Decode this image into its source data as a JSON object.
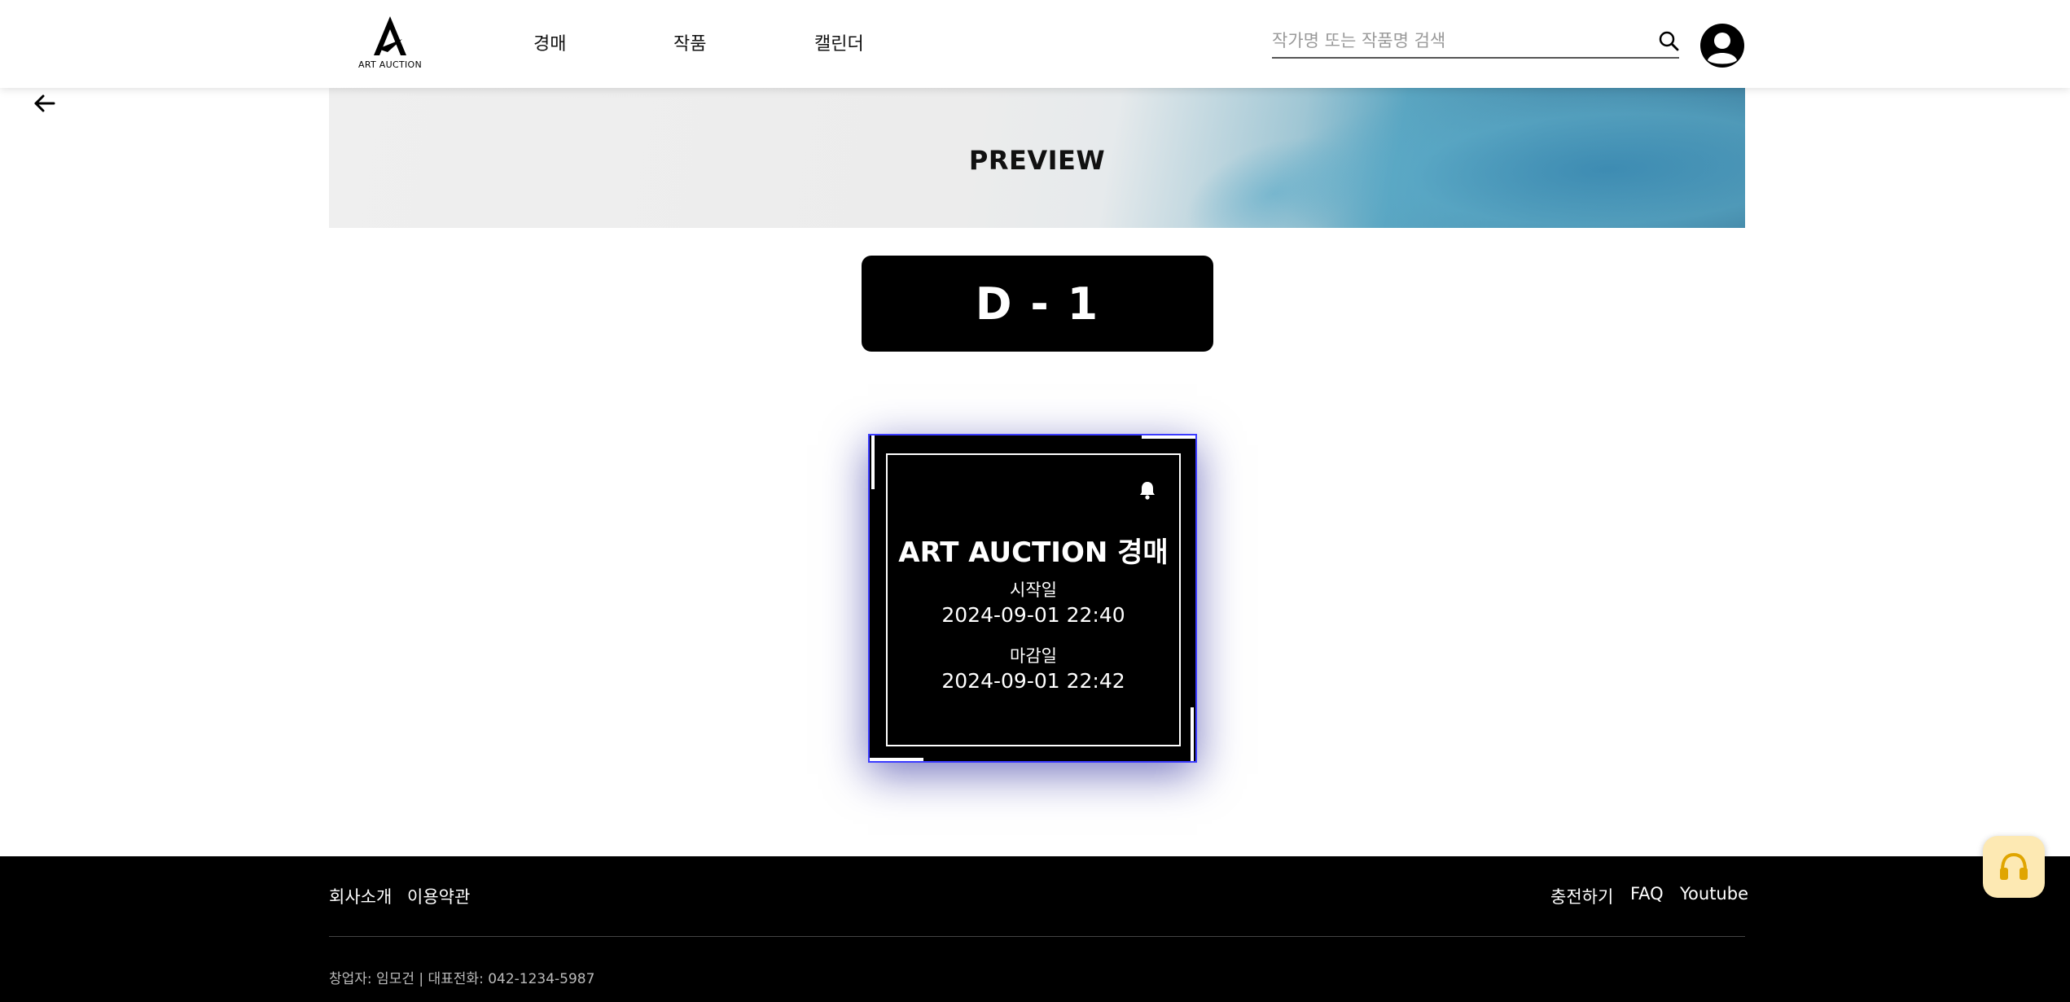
{
  "header": {
    "logo_text": "ART AUCTION",
    "nav": [
      "경매",
      "작품",
      "캘린더"
    ],
    "search_placeholder": "작가명 또는 작품명 검색"
  },
  "banner": {
    "title": "PREVIEW"
  },
  "countdown": {
    "label": "D - 1"
  },
  "auction_card": {
    "title": "ART AUCTION 경매",
    "start_label": "시작일",
    "start_date": "2024-09-01 22:40",
    "end_label": "마감일",
    "end_date": "2024-09-01 22:42"
  },
  "footer": {
    "left_links": [
      "회사소개",
      "이용약관"
    ],
    "right_links": [
      "충전하기",
      "FAQ",
      "Youtube"
    ],
    "info": "창업자: 임모건 | 대표전화: 042-1234-5987"
  },
  "colors": {
    "card_border": "#3b3bff",
    "support_button": "#fde9b3",
    "support_icon": "#e0a500"
  },
  "icons": [
    "logo-icon",
    "search-icon",
    "user-icon",
    "back-arrow-icon",
    "bell-icon",
    "headset-icon"
  ]
}
